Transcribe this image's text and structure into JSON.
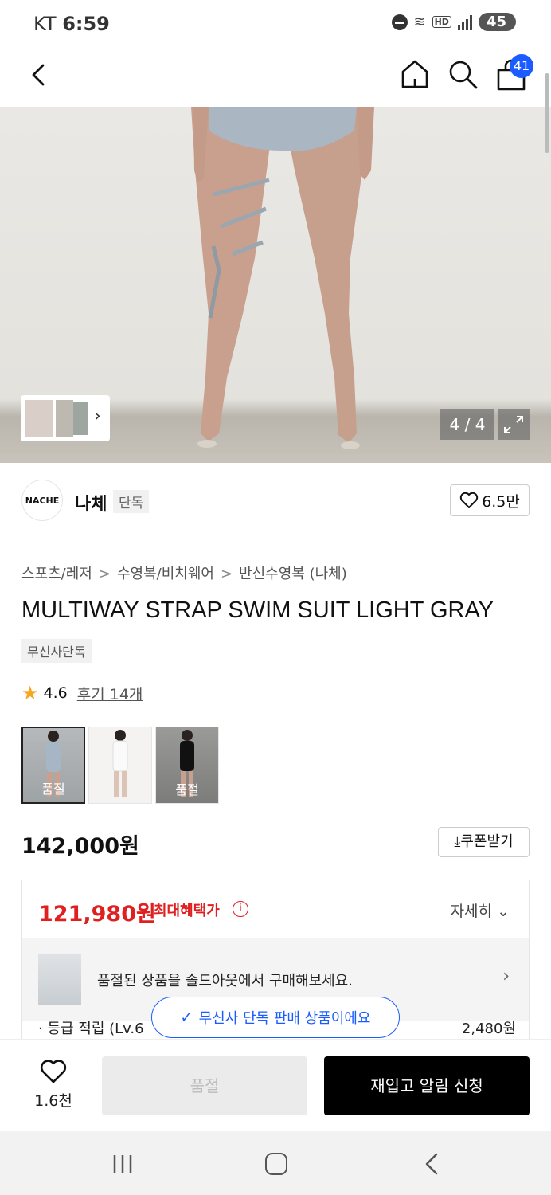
{
  "status_bar": {
    "carrier": "KT",
    "time": "6:59",
    "battery": "45"
  },
  "header": {
    "cart_count": "41"
  },
  "gallery": {
    "counter": "4 / 4"
  },
  "brand": {
    "logo_text": "NACHE",
    "name": "나체",
    "tag": "단독",
    "likes": "6.5만"
  },
  "product": {
    "breadcrumb": [
      "스포츠/레저",
      "수영복/비치웨어",
      "반신수영복 (나체)"
    ],
    "title": "MULTIWAY STRAP SWIM SUIT LIGHT GRAY",
    "badge": "무신사단독",
    "rating": "4.6",
    "reviews": "후기 14개",
    "variants": [
      {
        "label": "품절",
        "selected": true
      },
      {
        "label": "",
        "selected": false
      },
      {
        "label": "품절",
        "selected": false
      }
    ],
    "price": "142,000원",
    "coupon_label": "쿠폰받기"
  },
  "benefit": {
    "price": "121,980원",
    "label": "최대혜택가",
    "detail_label": "자세히",
    "soldout_message": "품절된 상품을 솔드아웃에서 구매해보세요.",
    "cut_left": "· 등급 적립 (Lv.6",
    "cut_right": "2,480원"
  },
  "toast": {
    "text": "무신사 단독 판매 상품이에요"
  },
  "purchase_bar": {
    "wish_count": "1.6천",
    "soldout_label": "품절",
    "restock_label": "재입고 알림 신청"
  },
  "colors": {
    "accent": "#1a5cff",
    "sale": "#e02020",
    "rating_star": "#f5a623"
  }
}
